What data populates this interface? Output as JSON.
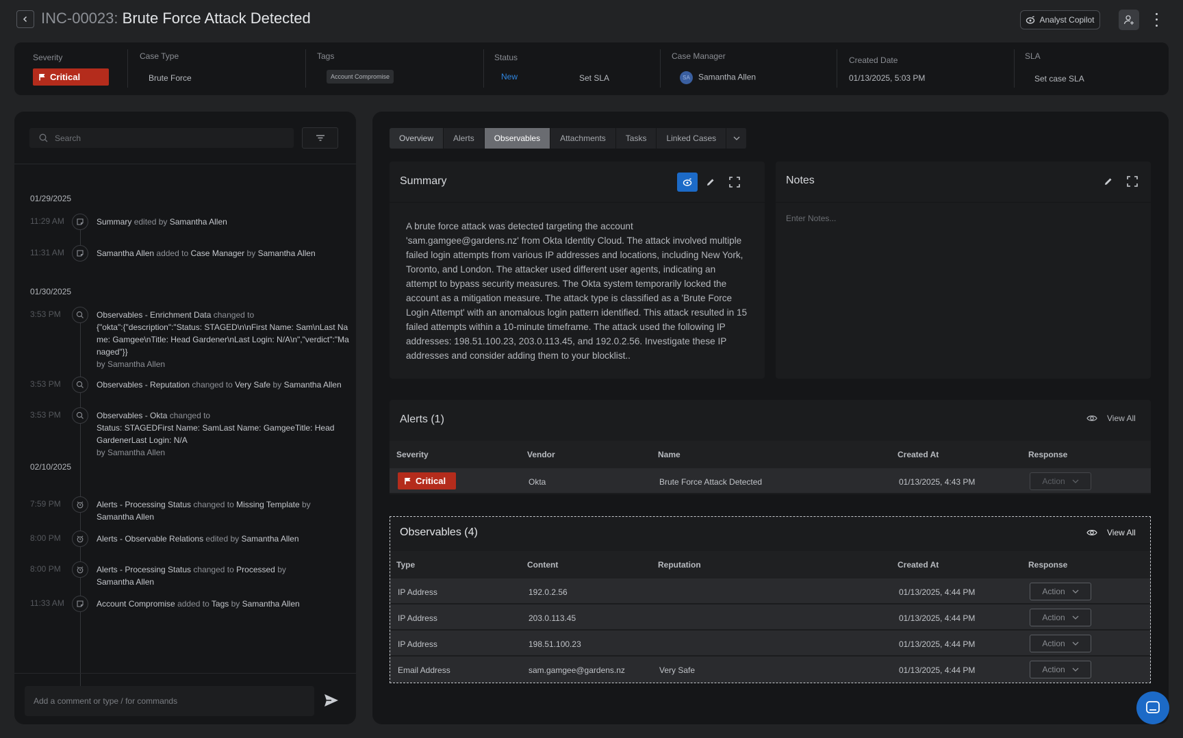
{
  "header": {
    "incident_id": "INC-00023:",
    "incident_title": "Brute Force Attack Detected",
    "copilot_label": "Analyst Copilot"
  },
  "meta": {
    "severity_label": "Severity",
    "severity_value": "Critical",
    "case_type_label": "Case Type",
    "case_type_value": "Brute Force",
    "tags_label": "Tags",
    "tag_value": "Account Compromise",
    "status_label": "Status",
    "status_value": "New",
    "status_sla": "Set SLA",
    "case_manager_label": "Case Manager",
    "case_manager_initials": "SA",
    "case_manager_value": "Samantha Allen",
    "created_label": "Created Date",
    "created_value": "01/13/2025, 5:03 PM",
    "sla_label": "SLA",
    "sla_value": "Set case SLA"
  },
  "colors": {
    "critical": "#b42c1c",
    "accent_blue": "#1c6ac7",
    "status_new": "#2f86e0"
  },
  "timeline": {
    "search_placeholder": "Search",
    "comment_placeholder": "Add a comment or type / for commands",
    "clipped_event": {
      "time": "7:59 PM",
      "parts": [
        "Alerts - Observable Relations",
        "edited by",
        "Samantha Allen"
      ]
    },
    "dates": [
      "01/29/2025",
      "01/30/2025",
      "02/10/2025"
    ],
    "events": [
      {
        "time": "11:29 AM",
        "icon": "note-icon",
        "parts": [
          "Summary",
          "edited by",
          "Samantha Allen"
        ]
      },
      {
        "time": "11:31 AM",
        "icon": "note-icon",
        "parts": [
          "Samantha Allen",
          "added to",
          "Case Manager",
          "by",
          "Samantha Allen"
        ]
      },
      {
        "time": "3:53 PM",
        "icon": "search-icon",
        "parts": [
          "Observables - Enrichment Data",
          "changed to"
        ],
        "body": "{\"okta\":{\"description\":\"Status: STAGED\\n\\nFirst Name: Sam\\nLast Name: Gamgee\\nTitle: Head Gardener\\nLast Login: N/A\\n\",\"verdict\":\"Managed\"}}",
        "by": "by Samantha Allen"
      },
      {
        "time": "3:53 PM",
        "icon": "search-icon",
        "parts": [
          "Observables - Reputation",
          "changed to",
          "Very Safe",
          "by",
          "Samantha Allen"
        ]
      },
      {
        "time": "3:53 PM",
        "icon": "search-icon",
        "parts": [
          "Observables - Okta",
          "changed to"
        ],
        "body": "Status: STAGEDFirst Name: SamLast Name: GamgeeTitle: Head GardenerLast Login: N/A",
        "by": "by Samantha Allen"
      },
      {
        "time": "7:59 PM",
        "icon": "alarm-icon",
        "parts": [
          "Alerts - Processing Status",
          "changed to",
          "Missing Template",
          "by",
          "Samantha Allen"
        ]
      },
      {
        "time": "8:00 PM",
        "icon": "alarm-icon",
        "parts": [
          "Alerts - Observable Relations",
          "edited by",
          "Samantha Allen"
        ]
      },
      {
        "time": "8:00 PM",
        "icon": "alarm-icon",
        "parts": [
          "Alerts - Processing Status",
          "changed to",
          "Processed",
          "by",
          "Samantha Allen"
        ]
      },
      {
        "time": "11:33 AM",
        "icon": "note-icon",
        "parts": [
          "Account Compromise",
          "added to",
          "Tags",
          "by",
          "Samantha Allen"
        ]
      }
    ]
  },
  "tabs": [
    "Overview",
    "Alerts",
    "Observables",
    "Attachments",
    "Tasks",
    "Linked Cases"
  ],
  "summary": {
    "title": "Summary",
    "text": "A brute force attack was detected targeting the account 'sam.gamgee@gardens.nz' from Okta Identity Cloud. The attack involved multiple failed login attempts from various IP addresses and locations, including New York, Toronto, and London. The attacker used different user agents, indicating an attempt to bypass security measures.  The Okta system temporarily locked the account as a mitigation measure. The attack type is classified as a 'Brute Force Login Attempt' with an anomalous login pattern identified. This attack resulted in 15 failed attempts within a 10-minute timeframe.  The attack used the following IP addresses: 198.51.100.23, 203.0.113.45, and 192.0.2.56.  Investigate these IP addresses and consider adding them to your blocklist.."
  },
  "notes": {
    "title": "Notes",
    "placeholder": "Enter Notes..."
  },
  "alerts": {
    "title": "Alerts (1)",
    "view_all": "View All",
    "columns": [
      "Severity",
      "Vendor",
      "Name",
      "Created At",
      "Response"
    ],
    "rows": [
      {
        "severity": "Critical",
        "vendor": "Okta",
        "name": "Brute Force Attack Detected",
        "created": "01/13/2025, 4:43 PM",
        "action": "Action"
      }
    ]
  },
  "observables": {
    "title": "Observables (4)",
    "view_all": "View All",
    "columns": [
      "Type",
      "Content",
      "Reputation",
      "Created At",
      "Response"
    ],
    "rows": [
      {
        "type": "IP Address",
        "content": "192.0.2.56",
        "reputation": "",
        "created": "01/13/2025, 4:44 PM",
        "action": "Action"
      },
      {
        "type": "IP Address",
        "content": "203.0.113.45",
        "reputation": "",
        "created": "01/13/2025, 4:44 PM",
        "action": "Action"
      },
      {
        "type": "IP Address",
        "content": "198.51.100.23",
        "reputation": "",
        "created": "01/13/2025, 4:44 PM",
        "action": "Action"
      },
      {
        "type": "Email Address",
        "content": "sam.gamgee@gardens.nz",
        "reputation": "Very Safe",
        "created": "01/13/2025, 4:44 PM",
        "action": "Action"
      }
    ]
  }
}
